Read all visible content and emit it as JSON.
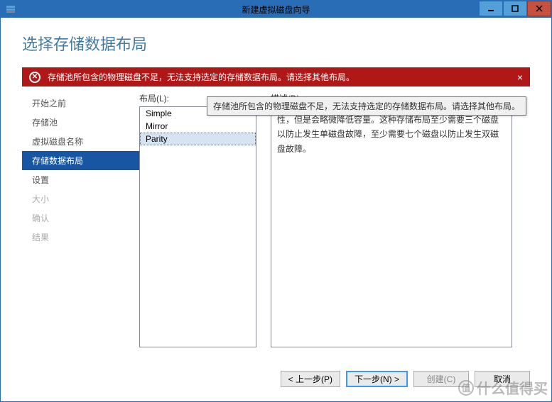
{
  "window": {
    "title": "新建虚拟磁盘向导"
  },
  "page": {
    "title": "选择存储数据布局"
  },
  "error": {
    "text": "存储池所包含的物理磁盘不足，无法支持选定的存储数据布局。请选择其他布局。",
    "close": "×"
  },
  "steps": [
    {
      "label": "开始之前",
      "state": "done"
    },
    {
      "label": "存储池",
      "state": "done"
    },
    {
      "label": "虚拟磁盘名称",
      "state": "done"
    },
    {
      "label": "存储数据布局",
      "state": "active"
    },
    {
      "label": "设置",
      "state": "pending"
    },
    {
      "label": "大小",
      "state": "disabled"
    },
    {
      "label": "确认",
      "state": "disabled"
    },
    {
      "label": "结果",
      "state": "disabled"
    }
  ],
  "labels": {
    "layout": "布局(L):",
    "description": "描述(D):"
  },
  "layouts": [
    {
      "name": "Simple",
      "selected": false
    },
    {
      "name": "Mirror",
      "selected": false
    },
    {
      "name": "Parity",
      "selected": true
    }
  ],
  "tooltip": "存储池所包含的物理磁盘不足，无法支持选定的存储数据布局。请选择其他布局。",
  "description": "性，但是会略微降低容量。这种存储布局至少需要三个磁盘以防止发生单磁盘故障，至少需要七个磁盘以防止发生双磁盘故障。",
  "buttons": {
    "prev": "< 上一步(P)",
    "next": "下一步(N) >",
    "create": "创建(C)",
    "cancel": "取消"
  },
  "watermark": "什么值得买"
}
